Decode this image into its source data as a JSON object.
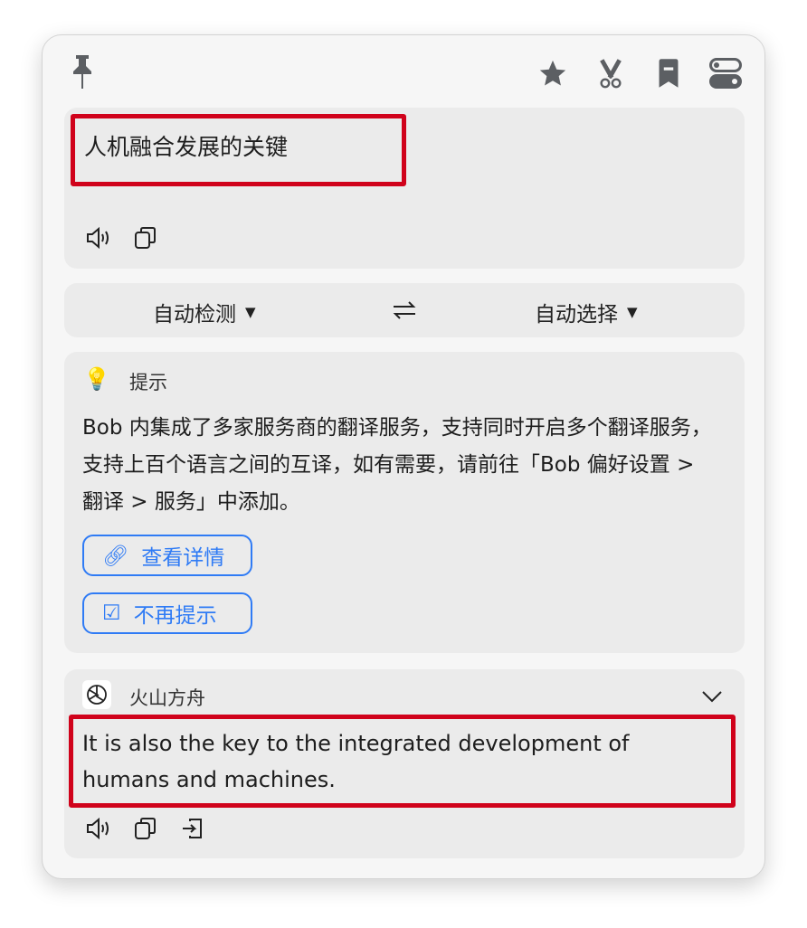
{
  "toolbar": {
    "icons": [
      "pin-icon",
      "star-icon",
      "scissors-icon",
      "bookmark-icon",
      "toggle-icon"
    ]
  },
  "source": {
    "text": "人机融合发展的关键"
  },
  "languages": {
    "from": "自动检测",
    "to": "自动选择",
    "swap_icon": "swap-arrows-icon"
  },
  "tip": {
    "title": "提示",
    "body": "Bob 内集成了多家服务商的翻译服务，支持同时开启多个翻译服务，支持上百个语言之间的互译，如有需要，请前往「Bob 偏好设置 > 翻译 > 服务」中添加。",
    "details_label": "查看详情",
    "dismiss_label": "不再提示"
  },
  "result": {
    "service": "火山方舟",
    "text": "It is also the key to the integrated development of humans and machines."
  },
  "colors": {
    "accent": "#2f7bf5",
    "highlight": "#d0021b"
  }
}
